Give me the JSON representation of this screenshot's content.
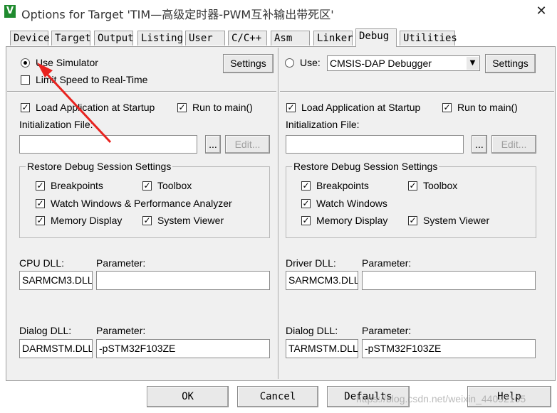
{
  "window": {
    "title": "Options for Target 'TIM—高级定时器-PWM互补输出带死区'",
    "app_icon_text": "V",
    "close_glyph": "✕"
  },
  "tabs": [
    {
      "label": "Device"
    },
    {
      "label": "Target"
    },
    {
      "label": "Output"
    },
    {
      "label": "Listing"
    },
    {
      "label": "User"
    },
    {
      "label": "C/C++"
    },
    {
      "label": "Asm"
    },
    {
      "label": "Linker"
    },
    {
      "label": "Debug",
      "active": true
    },
    {
      "label": "Utilities"
    }
  ],
  "left": {
    "use_simulator": {
      "label": "Use Simulator",
      "checked": true
    },
    "settings_button": "Settings",
    "limit_speed": {
      "label": "Limit Speed to Real-Time",
      "checked": false
    },
    "load_app": {
      "label": "Load Application at Startup",
      "checked": true
    },
    "run_to_main": {
      "label": "Run to main()",
      "checked": true
    },
    "init_file_label": "Initialization File:",
    "init_file_value": "",
    "browse_button": "...",
    "edit_button": "Edit...",
    "restore_group_title": "Restore Debug Session Settings",
    "breakpoints": {
      "label": "Breakpoints",
      "checked": true
    },
    "toolbox": {
      "label": "Toolbox",
      "checked": true
    },
    "watch_windows": {
      "label": "Watch Windows & Performance Analyzer",
      "checked": true
    },
    "memory_display": {
      "label": "Memory Display",
      "checked": true
    },
    "system_viewer": {
      "label": "System Viewer",
      "checked": true
    },
    "cpu_dll_label": "CPU DLL:",
    "cpu_dll_value": "SARMCM3.DLL",
    "cpu_param_label": "Parameter:",
    "cpu_param_value": "",
    "dialog_dll_label": "Dialog DLL:",
    "dialog_dll_value": "DARMSTM.DLL",
    "dialog_param_label": "Parameter:",
    "dialog_param_value": "-pSTM32F103ZE"
  },
  "right": {
    "use": {
      "label": "Use:",
      "checked": false
    },
    "debugger_select": "CMSIS-DAP Debugger",
    "settings_button": "Settings",
    "load_app": {
      "label": "Load Application at Startup",
      "checked": true
    },
    "run_to_main": {
      "label": "Run to main()",
      "checked": true
    },
    "init_file_label": "Initialization File:",
    "init_file_value": "",
    "browse_button": "...",
    "edit_button": "Edit...",
    "restore_group_title": "Restore Debug Session Settings",
    "breakpoints": {
      "label": "Breakpoints",
      "checked": true
    },
    "toolbox": {
      "label": "Toolbox",
      "checked": true
    },
    "watch_windows": {
      "label": "Watch Windows",
      "checked": true
    },
    "memory_display": {
      "label": "Memory Display",
      "checked": true
    },
    "system_viewer": {
      "label": "System Viewer",
      "checked": true
    },
    "driver_dll_label": "Driver DLL:",
    "driver_dll_value": "SARMCM3.DLL",
    "driver_param_label": "Parameter:",
    "driver_param_value": "",
    "dialog_dll_label": "Dialog DLL:",
    "dialog_dll_value": "TARMSTM.DLL",
    "dialog_param_label": "Parameter:",
    "dialog_param_value": "-pSTM32F103ZE"
  },
  "footer": {
    "ok": "OK",
    "cancel": "Cancel",
    "defaults": "Defaults",
    "help": "Help"
  },
  "watermark": "https://blog.csdn.net/weixin_44092105",
  "check_glyph": "✓",
  "annotation_arrow_color": "#e8231f"
}
